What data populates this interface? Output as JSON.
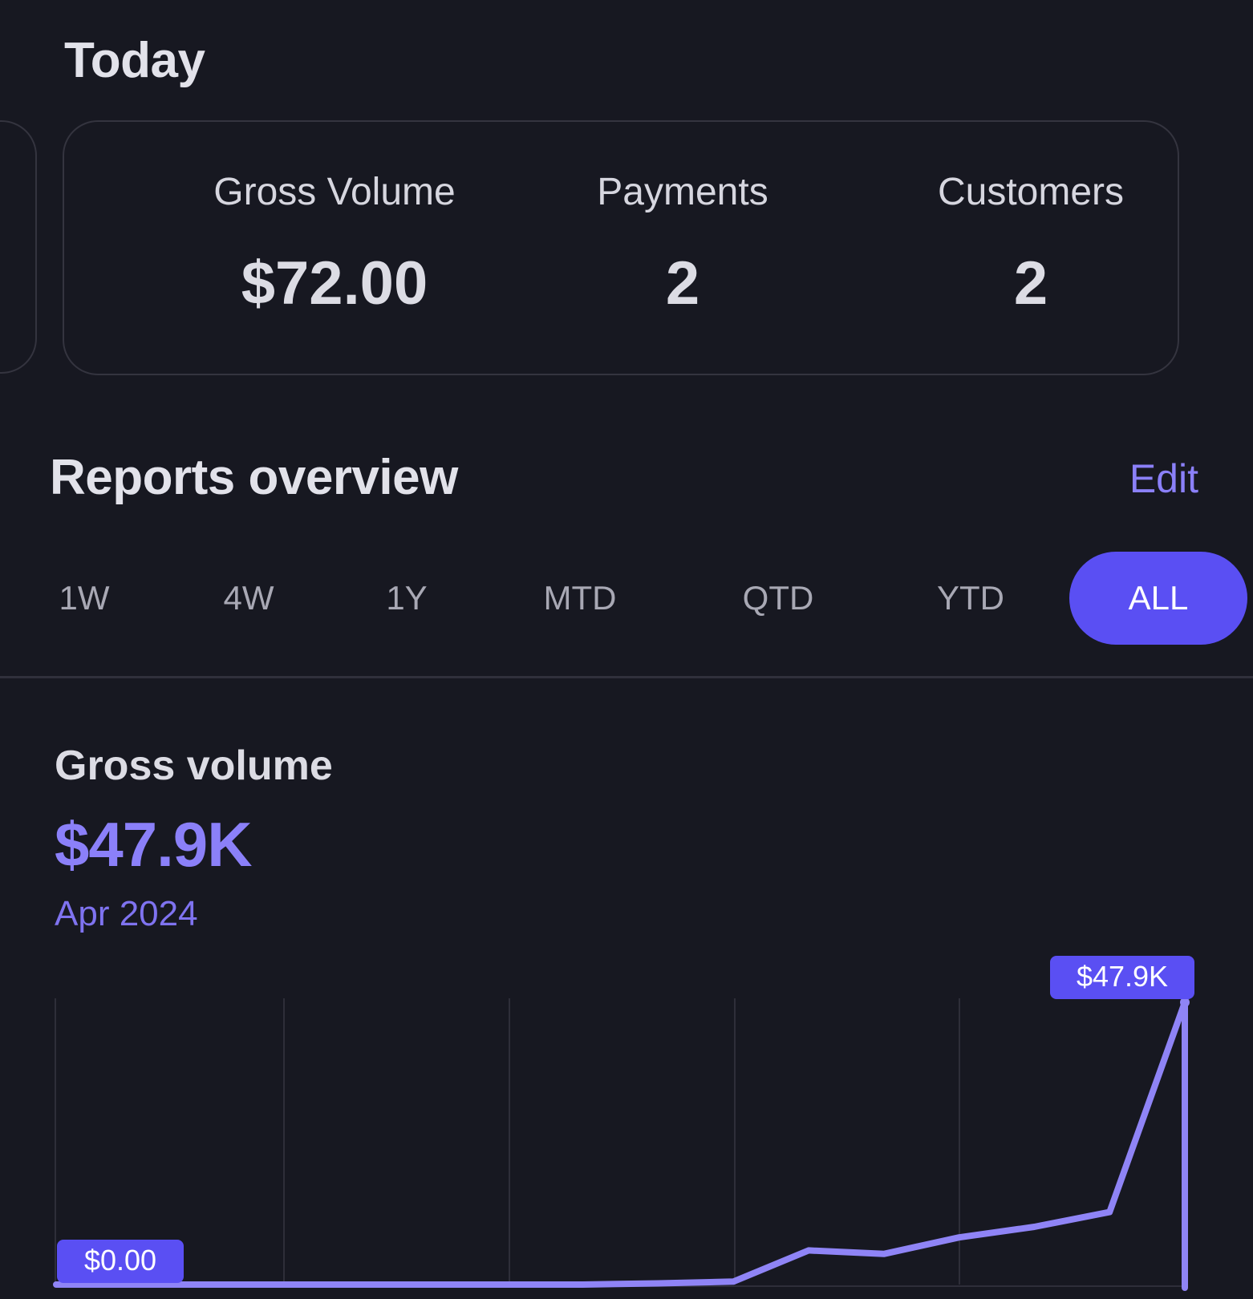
{
  "today": {
    "title": "Today",
    "stats": [
      {
        "label": "Gross Volume",
        "value": "$72.00"
      },
      {
        "label": "Payments",
        "value": "2"
      },
      {
        "label": "Customers",
        "value": "2"
      }
    ]
  },
  "reports": {
    "title": "Reports overview",
    "edit_label": "Edit",
    "ranges": [
      {
        "label": "1W",
        "active": false
      },
      {
        "label": "4W",
        "active": false
      },
      {
        "label": "1Y",
        "active": false
      },
      {
        "label": "MTD",
        "active": false
      },
      {
        "label": "QTD",
        "active": false
      },
      {
        "label": "YTD",
        "active": false
      },
      {
        "label": "ALL",
        "active": true
      }
    ]
  },
  "metric": {
    "name": "Gross volume",
    "value": "$47.9K",
    "date": "Apr 2024"
  },
  "colors": {
    "background": "#171821",
    "accent": "#5a4ff3",
    "accent_text": "#8b80f9",
    "line": "#8f84f6",
    "card_border": "#34343f"
  },
  "chart_data": {
    "type": "line",
    "x": [
      0,
      1,
      2,
      3,
      4,
      5,
      6,
      7,
      8,
      9,
      10,
      11,
      12,
      13,
      14,
      15
    ],
    "values": [
      0,
      0,
      0,
      0,
      0,
      0,
      0,
      0,
      200,
      500,
      5800,
      5200,
      8000,
      9800,
      12300,
      47900
    ],
    "ylim": [
      0,
      47900
    ],
    "min_label": "$0.00",
    "max_label": "$47.9K",
    "grid": true
  }
}
